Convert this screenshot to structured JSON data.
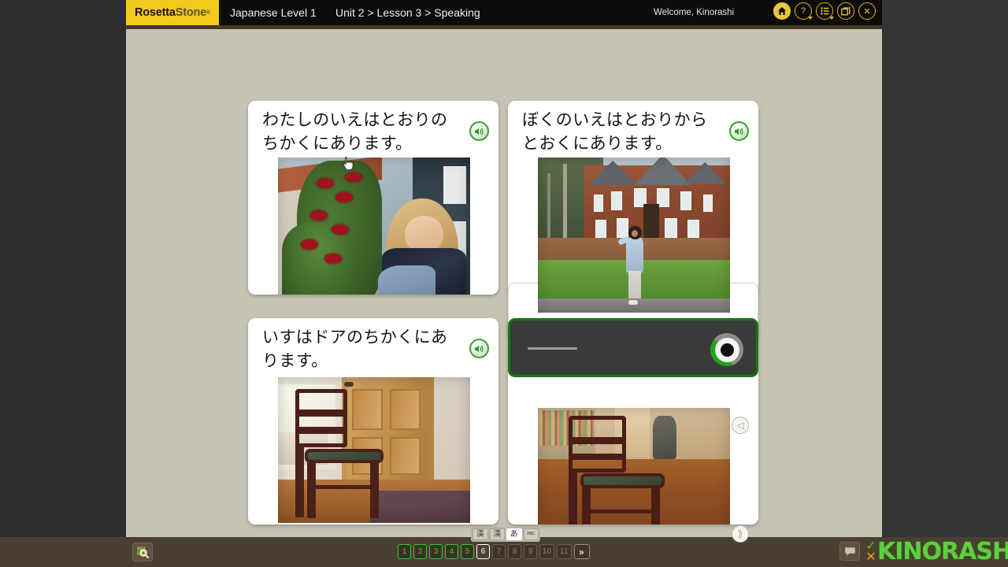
{
  "header": {
    "logo_rosetta": "Rosetta",
    "logo_stone": "Stone",
    "logo_tm": "®",
    "course_title": "Japanese Level 1",
    "breadcrumb": "Unit 2 > Lesson 3 > Speaking",
    "welcome": "Welcome, Kinorashi",
    "icons": [
      {
        "name": "home-icon",
        "glyph": "⌂"
      },
      {
        "name": "help-icon",
        "glyph": "?"
      },
      {
        "name": "menu-list-icon",
        "glyph": "≡"
      },
      {
        "name": "window-restore-icon",
        "glyph": "❐"
      },
      {
        "name": "close-icon",
        "glyph": "✕"
      }
    ]
  },
  "cards": [
    {
      "id": "card1",
      "text": "わたしのいえはとおりのちかくにあります。",
      "speaker_label": "play-audio",
      "image_alt": "Woman smiling in front of a house with red roses"
    },
    {
      "id": "card2",
      "text": "ぼくのいえはとおりからとおくにあります。",
      "speaker_label": "play-audio",
      "image_alt": "Child pointing at a large brick house set far back from the road"
    },
    {
      "id": "card3",
      "text": "いすはドアのちかくにあります。",
      "speaker_label": "play-audio",
      "image_alt": "Wooden chair standing next to a door"
    },
    {
      "id": "card4",
      "text": "",
      "speaker_label": "",
      "image_alt": "Wooden chair on a shop floor"
    }
  ],
  "recorder": {
    "state": "recording",
    "waveform_label": "audio-waveform",
    "record_button_label": "record"
  },
  "nav_arrows": {
    "prev": "◁",
    "next": "⟫"
  },
  "script_toggle": {
    "options": [
      {
        "label": "漢",
        "ruby": true,
        "selected": false,
        "name": "kanji-furigana"
      },
      {
        "label": "漢",
        "ruby": false,
        "selected": false,
        "name": "kanji"
      },
      {
        "label": "あ",
        "ruby": false,
        "selected": true,
        "name": "kana"
      },
      {
        "label": "ABC",
        "ruby": false,
        "selected": false,
        "name": "romaji"
      }
    ]
  },
  "bottom_bar": {
    "search_label": "search",
    "pages": [
      {
        "label": "1",
        "state": "done"
      },
      {
        "label": "2",
        "state": "done"
      },
      {
        "label": "3",
        "state": "done"
      },
      {
        "label": "4",
        "state": "done"
      },
      {
        "label": "5",
        "state": "done"
      },
      {
        "label": "6",
        "state": "current"
      },
      {
        "label": "7",
        "state": "upcoming"
      },
      {
        "label": "8",
        "state": "upcoming"
      },
      {
        "label": "9",
        "state": "upcoming"
      },
      {
        "label": "10",
        "state": "upcoming"
      },
      {
        "label": "11",
        "state": "upcoming"
      }
    ],
    "next_label": "»",
    "chat_label": "chat",
    "check_mark": "✓",
    "cross_mark": "✕",
    "watermark": "KINORASHI"
  },
  "colors": {
    "brand_yellow": "#f2cb1d",
    "header_black": "#0d0c0a",
    "stage_bg": "#c6c3b5",
    "bottom_bar": "#4a3f33",
    "record_green": "#14780f",
    "done_green": "#39c52e",
    "watermark_green": "#5ecf3f"
  }
}
